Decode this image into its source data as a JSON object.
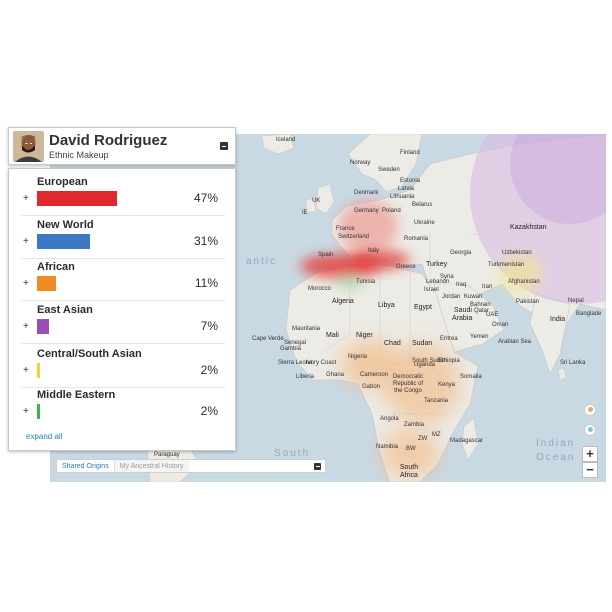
{
  "profile": {
    "name": "David Rodriguez",
    "subtitle": "Ethnic Makeup"
  },
  "ethnicities": [
    {
      "name": "European",
      "percent_label": "47%",
      "percent": 47,
      "color": "#e0282d"
    },
    {
      "name": "New World",
      "percent_label": "31%",
      "percent": 31,
      "color": "#3c78c4"
    },
    {
      "name": "African",
      "percent_label": "11%",
      "percent": 11,
      "color": "#f08a24"
    },
    {
      "name": "East Asian",
      "percent_label": "7%",
      "percent": 7,
      "color": "#9b4fb5"
    },
    {
      "name": "Central/South Asian",
      "percent_label": "2%",
      "percent": 2,
      "color": "#f2d33a"
    },
    {
      "name": "Middle Eastern",
      "percent_label": "2%",
      "percent": 2,
      "color": "#3fb24b"
    }
  ],
  "panel": {
    "row_toggle": "+",
    "expand_all": "expand all"
  },
  "map_tabs": {
    "active": "Shared Origins",
    "inactive": "My Ancestral History"
  },
  "map_controls": {
    "zoom_in": "+",
    "zoom_out": "−"
  },
  "map_labels": {
    "iceland": "Iceland",
    "norway": "Norway",
    "sweden": "Sweden",
    "finland": "Finland",
    "denmark": "Denmark",
    "uk": "UK",
    "ie": "IE",
    "estonia": "Estonia",
    "latvia": "Latvia",
    "lithuania": "Lithuania",
    "belarus": "Belarus",
    "germany": "Germany",
    "poland": "Poland",
    "ukraine": "Ukraine",
    "france": "France",
    "switzerland": "Switzerland",
    "italy": "Italy",
    "spain": "Spain",
    "greece": "Greece",
    "romania": "Romania",
    "turkey": "Turkey",
    "georgia": "Georgia",
    "kazakhstan": "Kazakhstan",
    "uzbekistan": "Uzbekistan",
    "turkmenistan": "Turkmenistan",
    "afghanistan": "Afghanistan",
    "pakistan": "Pakistan",
    "nepal": "Nepal",
    "bangladesh": "Banglade",
    "india": "India",
    "iran": "Iran",
    "iraq": "Iraq",
    "syria": "Syria",
    "lebanon": "Lebanon",
    "israel": "Israel",
    "jordan": "Jordan",
    "kuwait": "Kuwait",
    "bahrain": "Bahrain",
    "qatar": "Qatar",
    "uae": "UAE",
    "oman": "Oman",
    "saudi": "Saudi",
    "arabia": "Arabia",
    "yemen": "Yemen",
    "morocco": "Morocco",
    "algeria": "Algeria",
    "tunisia": "Tunisia",
    "libya": "Libya",
    "egypt": "Egypt",
    "mauritania": "Mauritania",
    "mali": "Mali",
    "niger": "Niger",
    "chad": "Chad",
    "sudan": "Sudan",
    "south_sudan": "South Sudan",
    "eritrea": "Eritrea",
    "ethiopia": "Ethiopia",
    "somalia": "Somalia",
    "nigeria": "Nigeria",
    "cameroon": "Cameroon",
    "gabon": "Gabon",
    "ghana": "Ghana",
    "ivory_coast": "Ivory Coast",
    "liberia": "Liberia",
    "sierra": "Sierra Leone",
    "senegal": "Senegal",
    "gambia": "Gambia",
    "cape_verde": "Cape Verde",
    "drc": "Democratic Republic of the Congo",
    "kenya": "Kenya",
    "uganda": "Uganda",
    "tanzania": "Tanzania",
    "angola": "Angola",
    "zambia": "Zambia",
    "zimbabwe": "ZW",
    "mozambique": "MZ",
    "namibia": "Namibia",
    "botswana": "BW",
    "madagascar": "Madagascar",
    "south_africa": "South Africa",
    "sri_lanka": "Sri Lanka",
    "paraguay": "Paraguay",
    "arabian_sea": "Arabian Sea",
    "ocean_south": "South",
    "ocean_indian": "Indian",
    "ocean_ocean": "Ocean",
    "atlantic": "antic"
  }
}
